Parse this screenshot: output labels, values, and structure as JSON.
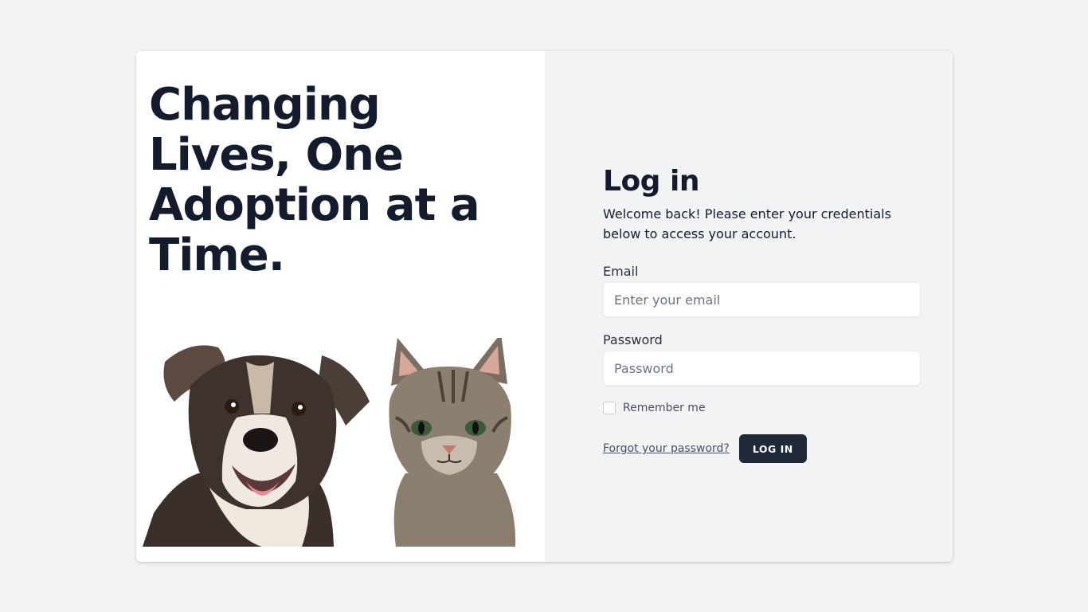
{
  "hero": {
    "headline": "Changing Lives, One Adoption at a Time.",
    "image_subjects": [
      "dog",
      "cat"
    ]
  },
  "login": {
    "title": "Log in",
    "subtitle": "Welcome back! Please enter your credentials below to access your account.",
    "email": {
      "label": "Email",
      "placeholder": "Enter your email",
      "value": ""
    },
    "password": {
      "label": "Password",
      "placeholder": "Password",
      "value": ""
    },
    "remember_label": "Remember me",
    "remember_checked": false,
    "forgot_link": "Forgot your password?",
    "submit_label": "LOG IN"
  },
  "colors": {
    "page_background": "#f2f3f5",
    "panel_background": "#ffffff",
    "heading_text": "#141b2d",
    "button_background": "#1f2937",
    "button_text": "#ffffff"
  }
}
